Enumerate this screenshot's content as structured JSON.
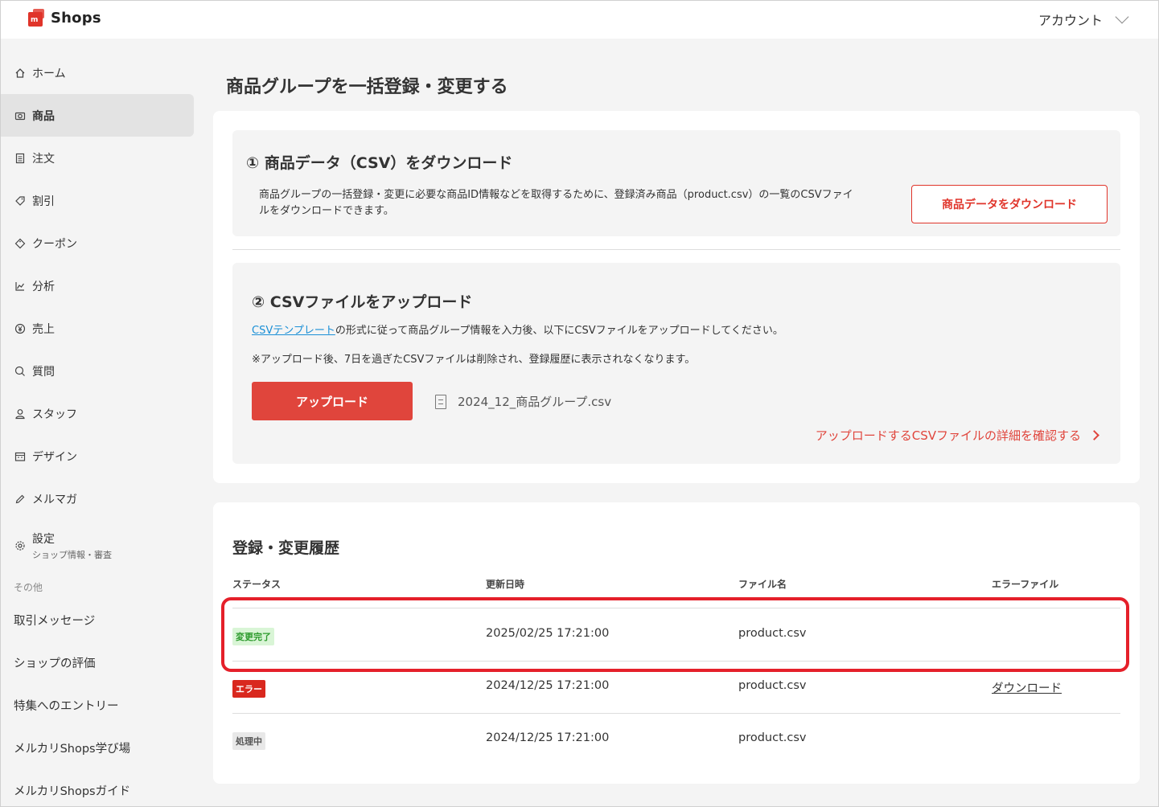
{
  "header": {
    "brand": "Shops",
    "account_label": "アカウント"
  },
  "sidebar": {
    "items": [
      {
        "label": "ホーム",
        "icon": "home-icon"
      },
      {
        "label": "商品",
        "icon": "camera-icon",
        "active": true
      },
      {
        "label": "注文",
        "icon": "document-icon"
      },
      {
        "label": "割引",
        "icon": "tag-icon"
      },
      {
        "label": "クーポン",
        "icon": "coupon-icon"
      },
      {
        "label": "分析",
        "icon": "chart-icon"
      },
      {
        "label": "売上",
        "icon": "yen-icon"
      },
      {
        "label": "質問",
        "icon": "question-icon"
      },
      {
        "label": "スタッフ",
        "icon": "person-icon"
      },
      {
        "label": "デザイン",
        "icon": "store-icon"
      },
      {
        "label": "メルマガ",
        "icon": "pen-icon"
      },
      {
        "label": "設定",
        "sub": "ショップ情報・審査",
        "icon": "gear-icon"
      }
    ],
    "other_label": "その他",
    "other_items": [
      "取引メッセージ",
      "ショップの評価",
      "特集へのエントリー",
      "メルカリShops学び場",
      "メルカリShopsガイド"
    ]
  },
  "main": {
    "title": "商品グループを一括登録・変更する",
    "step1": {
      "title": "① 商品データ（CSV）をダウンロード",
      "desc_line1": "商品グループの一括登録・変更に必要な商品ID情報などを取得するために、登録済み商品（product.csv）の一覧のCSVファイ",
      "desc_line2": "ルをダウンロードできます。",
      "button": "商品データをダウンロード"
    },
    "step2": {
      "title": "② CSVファイルをアップロード",
      "template_link": "CSVテンプレート",
      "desc1": "の形式に従って商品グループ情報を入力後、以下にCSVファイルをアップロードしてください。",
      "desc2": "※アップロード後、7日を過ぎたCSVファイルは削除され、登録履歴に表示されなくなります。",
      "upload_button": "アップロード",
      "file_name": "2024_12_商品グループ.csv",
      "detail_link": "アップロードするCSVファイルの詳細を確認する"
    },
    "history": {
      "title": "登録・変更履歴",
      "columns": [
        "ステータス",
        "更新日時",
        "ファイル名",
        "エラーファイル"
      ],
      "rows": [
        {
          "status": "変更完了",
          "datetime": "2025/02/25  17:21:00",
          "file": "product.csv",
          "error_file": ""
        },
        {
          "status": "エラー",
          "datetime": "2024/12/25  17:21:00",
          "file": "product.csv",
          "error_file": "ダウンロード"
        },
        {
          "status": "処理中",
          "datetime": "2024/12/25  17:21:00",
          "file": "product.csv",
          "error_file": ""
        }
      ]
    }
  },
  "colors": {
    "accent": "#e0342a",
    "link": "#1a8fd6",
    "highlight": "#e5202a"
  }
}
